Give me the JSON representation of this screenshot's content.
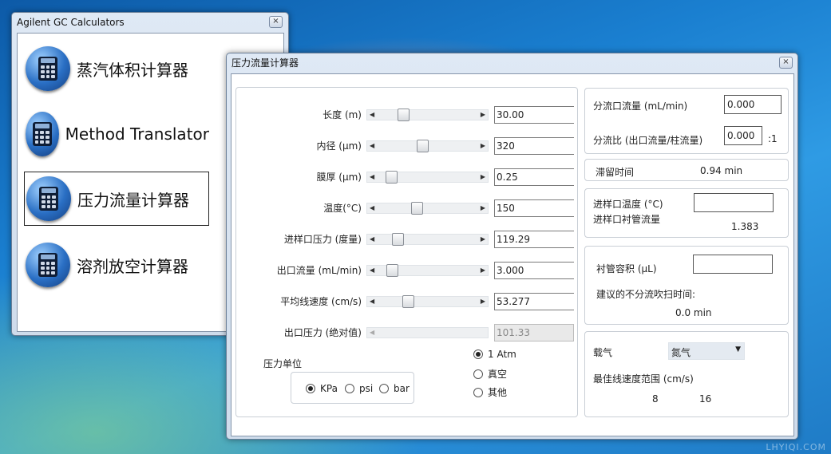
{
  "desktop": {
    "watermark": "LHYIQI.COM"
  },
  "launcher": {
    "title": "Agilent GC Calculators",
    "close_glyph": "×",
    "items": [
      {
        "label": "蒸汽体积计算器",
        "icon": "calculator-icon"
      },
      {
        "label": "Method Translator",
        "icon": "calculator-icon"
      },
      {
        "label": "压力流量计算器",
        "icon": "calculator-icon",
        "selected": true
      },
      {
        "label": "溶剂放空计算器",
        "icon": "calculator-icon"
      }
    ]
  },
  "calc": {
    "title": "压力流量计算器",
    "close_glyph": "×",
    "arrow_left": "◀",
    "arrow_right": "▶",
    "params": [
      {
        "label": "长度 (m)",
        "value": "30.00",
        "slider": 0.25
      },
      {
        "label": "内径 (μm)",
        "value": "320",
        "slider": 0.45
      },
      {
        "label": "膜厚 (μm)",
        "value": "0.25",
        "slider": 0.13
      },
      {
        "label": "温度(°C)",
        "value": "150",
        "slider": 0.39
      },
      {
        "label": "进样口压力 (度量)",
        "value": "119.29",
        "slider": 0.2
      },
      {
        "label": "出口流量 (mL/min)",
        "value": "3.000",
        "slider": 0.14
      },
      {
        "label": "平均线速度 (cm/s)",
        "value": "53.277",
        "slider": 0.3
      },
      {
        "label": "出口压力 (绝对值)",
        "value": "101.33",
        "disabled": true
      }
    ],
    "pressure_unit": {
      "label": "压力单位",
      "options": [
        "KPa",
        "psi",
        "bar"
      ],
      "selected": "KPa"
    },
    "outlet_options": {
      "options": [
        "1 Atm",
        "真空",
        "其他"
      ],
      "selected": "1 Atm"
    },
    "split": {
      "flow_label": "分流口流量 (mL/min)",
      "flow_value": "0.000",
      "ratio_label": "分流比 (出口流量/柱流量)",
      "ratio_value": "0.000",
      "ratio_suffix": ":1"
    },
    "holdup": {
      "label": "滞留时间",
      "value": "0.94 min"
    },
    "inlet": {
      "temp_label": "进样口温度 (°C)",
      "temp_value": "",
      "liner_flow_label": "进样口衬管流量",
      "liner_flow_value": "1.383"
    },
    "liner": {
      "volume_label": "衬管容积 (μL)",
      "volume_value": "",
      "purge_label": "建议的不分流吹扫时间:",
      "purge_value": "0.0 min"
    },
    "gas": {
      "label": "载气",
      "selected": "氮气",
      "dropdown_arrow": "▼",
      "range_label": "最佳线速度范围 (cm/s)",
      "range_min": "8",
      "range_max": "16"
    }
  },
  "colors": {
    "desktop": "#1a7fd0",
    "window_frame": "#cfdceb",
    "selection_border": "#222222"
  }
}
